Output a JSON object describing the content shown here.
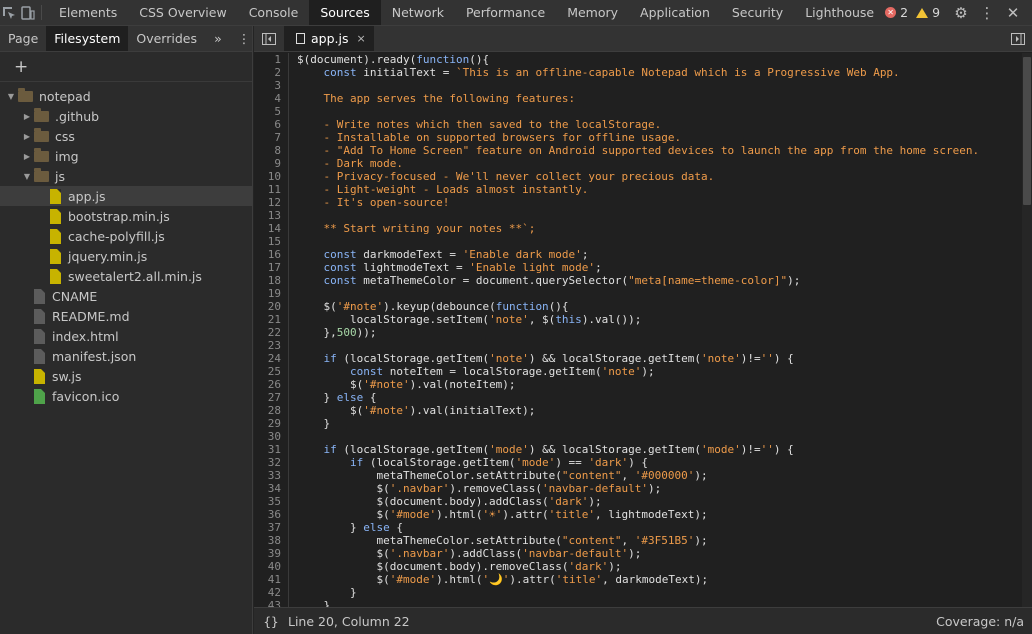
{
  "toolbar": {
    "tabs": [
      "Elements",
      "CSS Overview",
      "Console",
      "Sources",
      "Network",
      "Performance",
      "Memory",
      "Application",
      "Security",
      "Lighthouse"
    ],
    "active_tab": "Sources",
    "errors": "2",
    "warnings": "9"
  },
  "navigator": {
    "tabs": [
      "Page",
      "Filesystem",
      "Overrides"
    ],
    "active_tab": "Filesystem",
    "more": "»",
    "add": "+",
    "tree": [
      {
        "label": "notepad",
        "type": "folder",
        "depth": 0,
        "expanded": true
      },
      {
        "label": ".github",
        "type": "folder",
        "depth": 1,
        "expanded": false
      },
      {
        "label": "css",
        "type": "folder",
        "depth": 1,
        "expanded": false
      },
      {
        "label": "img",
        "type": "folder",
        "depth": 1,
        "expanded": false
      },
      {
        "label": "js",
        "type": "folder",
        "depth": 1,
        "expanded": true
      },
      {
        "label": "app.js",
        "type": "file",
        "color": "yellow",
        "depth": 2,
        "selected": true
      },
      {
        "label": "bootstrap.min.js",
        "type": "file",
        "color": "yellow",
        "depth": 2
      },
      {
        "label": "cache-polyfill.js",
        "type": "file",
        "color": "yellow",
        "depth": 2
      },
      {
        "label": "jquery.min.js",
        "type": "file",
        "color": "yellow",
        "depth": 2
      },
      {
        "label": "sweetalert2.all.min.js",
        "type": "file",
        "color": "yellow",
        "depth": 2
      },
      {
        "label": "CNAME",
        "type": "file",
        "color": "gray",
        "depth": 1
      },
      {
        "label": "README.md",
        "type": "file",
        "color": "gray",
        "depth": 1
      },
      {
        "label": "index.html",
        "type": "file",
        "color": "gray",
        "depth": 1
      },
      {
        "label": "manifest.json",
        "type": "file",
        "color": "gray",
        "depth": 1
      },
      {
        "label": "sw.js",
        "type": "file",
        "color": "yellow",
        "depth": 1
      },
      {
        "label": "favicon.ico",
        "type": "file",
        "color": "green",
        "depth": 1
      }
    ]
  },
  "editor": {
    "tab_label": "app.js",
    "close": "×",
    "lines": [
      "$(document).ready(function(){",
      "    const initialText = `This is an offline-capable Notepad which is a Progressive Web App.",
      "",
      "    The app serves the following features:",
      "",
      "    - Write notes which then saved to the localStorage.",
      "    - Installable on supported browsers for offline usage.",
      "    - \"Add To Home Screen\" feature on Android supported devices to launch the app from the home screen.",
      "    - Dark mode.",
      "    - Privacy-focused - We'll never collect your precious data.",
      "    - Light-weight - Loads almost instantly.",
      "    - It's open-source!",
      "",
      "    ** Start writing your notes **`;",
      "",
      "    const darkmodeText = 'Enable dark mode';",
      "    const lightmodeText = 'Enable light mode';",
      "    const metaThemeColor = document.querySelector(\"meta[name=theme-color]\");",
      "",
      "    $('#note').keyup(debounce(function(){",
      "        localStorage.setItem('note', $(this).val());",
      "    },500));",
      "",
      "    if (localStorage.getItem('note') && localStorage.getItem('note')!='') {",
      "        const noteItem = localStorage.getItem('note');",
      "        $('#note').val(noteItem);",
      "    } else {",
      "        $('#note').val(initialText);",
      "    }",
      "",
      "    if (localStorage.getItem('mode') && localStorage.getItem('mode')!='') {",
      "        if (localStorage.getItem('mode') == 'dark') {",
      "            metaThemeColor.setAttribute(\"content\", '#000000');",
      "            $('.navbar').removeClass('navbar-default');",
      "            $(document.body).addClass('dark');",
      "            $('#mode').html('☀').attr('title', lightmodeText);",
      "        } else {",
      "            metaThemeColor.setAttribute(\"content\", '#3F51B5');",
      "            $('.navbar').addClass('navbar-default');",
      "            $(document.body).removeClass('dark');",
      "            $('#mode').html('🌙').attr('title', darkmodeText);",
      "        }",
      "    }"
    ]
  },
  "status": {
    "braces": "{}",
    "position": "Line 20, Column 22",
    "coverage": "Coverage: n/a"
  }
}
